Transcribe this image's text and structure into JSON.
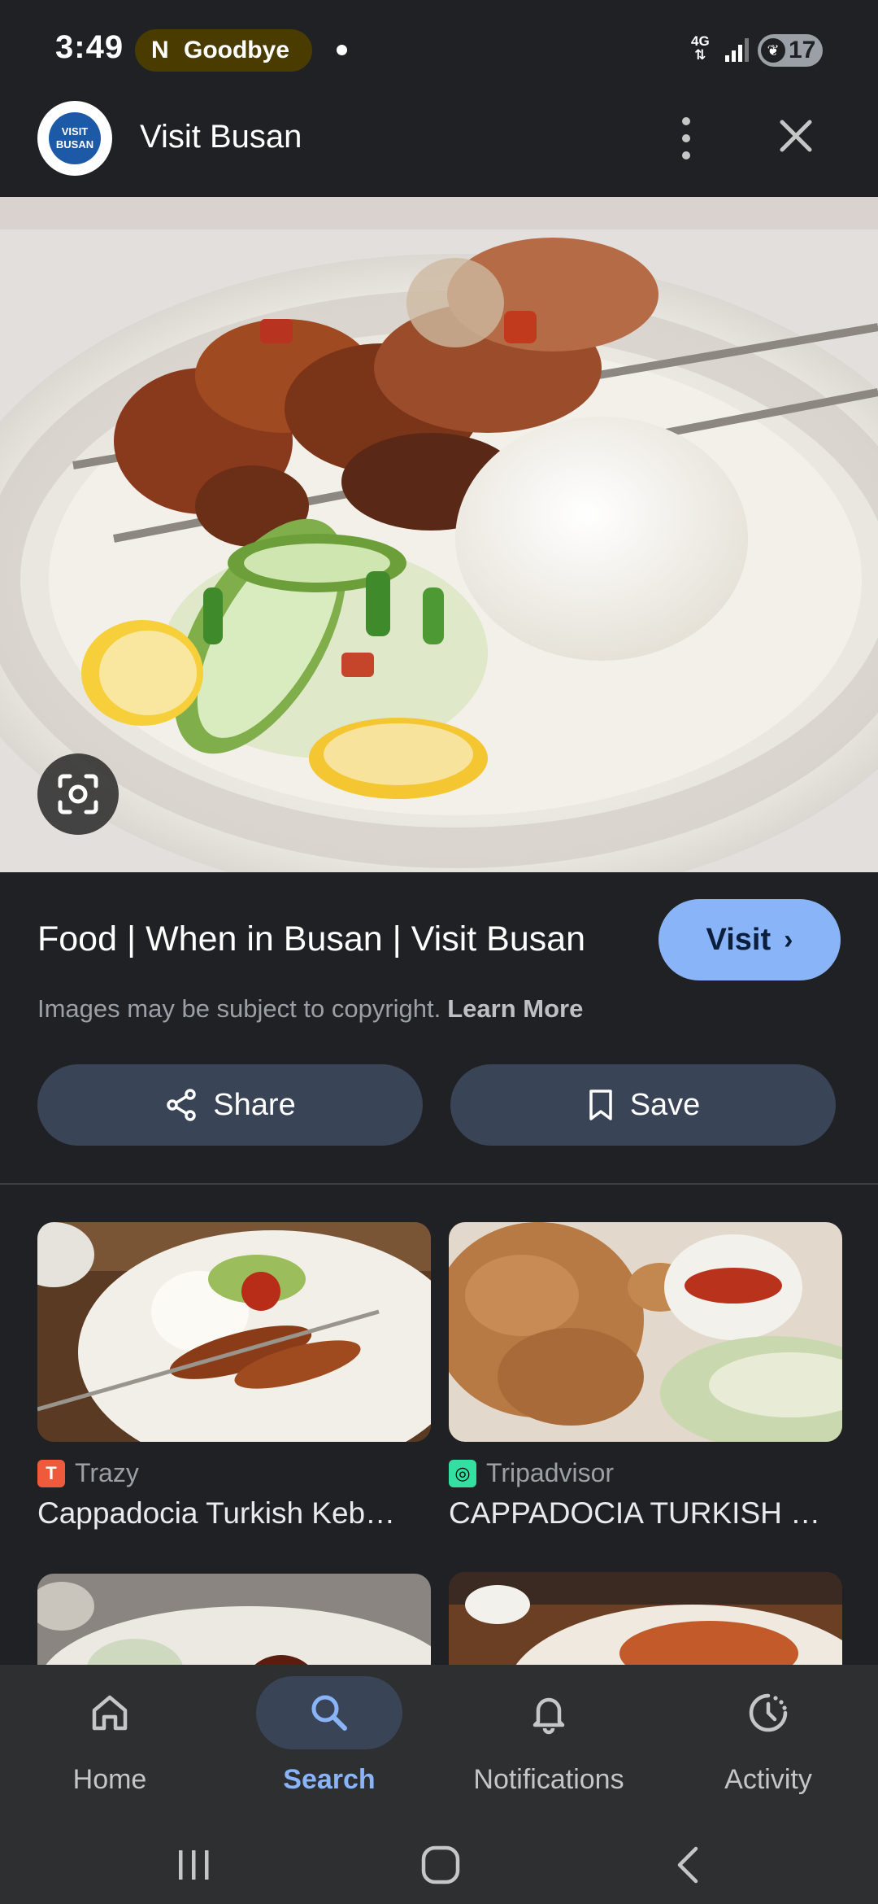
{
  "status_bar": {
    "time": "3:49",
    "media_pill_text": "Goodbye",
    "network": "4G",
    "battery": "17"
  },
  "header": {
    "site_name": "Visit Busan",
    "logo_text": "VISIT BUSAN"
  },
  "main": {
    "title": "Food | When in Busan | Visit Busan",
    "visit_label": "Visit",
    "copyright_text": "Images may be subject to copyright.",
    "learn_more_label": "Learn More",
    "share_label": "Share",
    "save_label": "Save"
  },
  "results": [
    {
      "source": "Trazy",
      "source_icon": "trazy-icon",
      "caption": "Cappadocia Turkish Keb…"
    },
    {
      "source": "Tripadvisor",
      "source_icon": "tripadvisor-icon",
      "caption": "CAPPADOCIA TURKISH …"
    }
  ],
  "bottom_nav": {
    "items": [
      {
        "label": "Home",
        "icon": "home-icon"
      },
      {
        "label": "Search",
        "icon": "search-icon",
        "active": true
      },
      {
        "label": "Notifications",
        "icon": "bell-icon"
      },
      {
        "label": "Activity",
        "icon": "activity-icon"
      }
    ]
  },
  "colors": {
    "background": "#202124",
    "accent": "#8ab4f8",
    "button_bg": "#394457",
    "nav_bg": "#2d2f31"
  }
}
